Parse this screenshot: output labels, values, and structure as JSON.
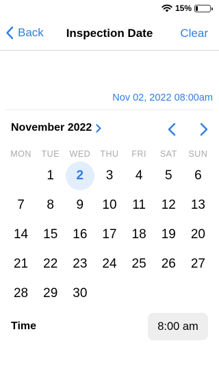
{
  "status_bar": {
    "battery_percent": "15%",
    "battery_level": 0.15
  },
  "nav": {
    "back_label": "Back",
    "title": "Inspection Date",
    "clear_label": "Clear"
  },
  "selected_value": "Nov 02, 2022 08:00am",
  "calendar": {
    "month_label": "November 2022",
    "weekdays": [
      "MON",
      "TUE",
      "WED",
      "THU",
      "FRI",
      "SAT",
      "SUN"
    ],
    "leading_blanks": 1,
    "selected_day": "2",
    "days": [
      "1",
      "2",
      "3",
      "4",
      "5",
      "6",
      "7",
      "8",
      "9",
      "10",
      "11",
      "12",
      "13",
      "14",
      "15",
      "16",
      "17",
      "18",
      "19",
      "20",
      "21",
      "22",
      "23",
      "24",
      "25",
      "26",
      "27",
      "28",
      "29",
      "30"
    ]
  },
  "time": {
    "label": "Time",
    "value": "8:00 am"
  },
  "icons": {
    "wifi": "wifi-icon",
    "back": "chevron-left-icon",
    "month_expand": "chevron-right-icon",
    "prev": "chevron-left-icon",
    "next": "chevron-right-icon"
  },
  "colors": {
    "accent": "#2f7de1",
    "selected_bg": "#e3eefc",
    "weekday": "#a9a9a9"
  }
}
